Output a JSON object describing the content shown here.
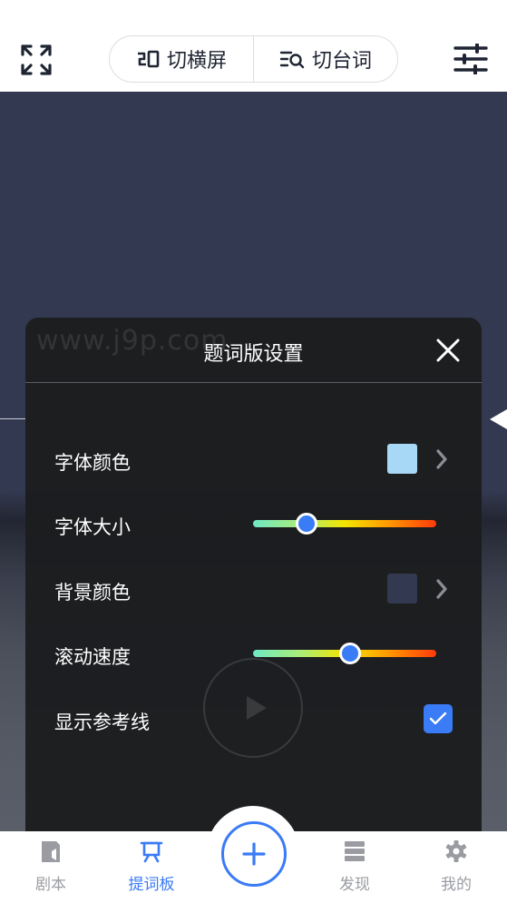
{
  "toolbar": {
    "expand_icon": "fullscreen-expand-icon",
    "landscape_label": "切横屏",
    "landscape_icon": "landscape-icon",
    "switch_lines_label": "切台词",
    "switch_lines_icon": "search-list-icon",
    "settings_icon": "sliders-icon"
  },
  "panel": {
    "watermark": "www.j9p.com",
    "title": "题词版设置",
    "close_icon": "close-icon",
    "rows": [
      {
        "label": "字体颜色",
        "type": "color",
        "color": "#a7d8f5"
      },
      {
        "label": "字体大小",
        "type": "slider",
        "value": 0.29
      },
      {
        "label": "背景颜色",
        "type": "color",
        "color": "#333950"
      },
      {
        "label": "滚动速度",
        "type": "slider",
        "value": 0.53
      },
      {
        "label": "显示参考线",
        "type": "checkbox",
        "checked": true
      }
    ]
  },
  "tabbar": {
    "tabs": [
      {
        "label": "剧本",
        "icon": "script-book-icon",
        "active": false
      },
      {
        "label": "提词板",
        "icon": "teleprompter-icon",
        "active": true
      },
      {
        "label": "发现",
        "icon": "discover-list-icon",
        "active": false
      },
      {
        "label": "我的",
        "icon": "gear-icon",
        "active": false
      }
    ],
    "fab_icon": "plus-icon"
  },
  "colors": {
    "accent": "#3a7bf6",
    "stage_background": "#333950",
    "panel_background": "#1c1d1f"
  }
}
